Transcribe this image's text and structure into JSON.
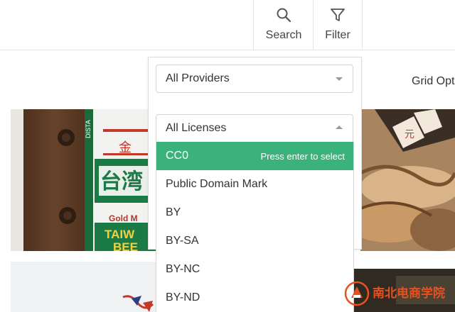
{
  "header": {
    "search_label": "Search",
    "filter_label": "Filter"
  },
  "grid_options_label": "Grid Opt",
  "filter": {
    "provider_select": {
      "value": "All Providers"
    },
    "license_select": {
      "value": "All Licenses"
    },
    "license_options": [
      {
        "label": "CC0",
        "hint": "Press enter to select",
        "active": true
      },
      {
        "label": "Public Domain Mark"
      },
      {
        "label": "BY"
      },
      {
        "label": "BY-SA"
      },
      {
        "label": "BY-NC"
      },
      {
        "label": "BY-ND"
      }
    ]
  },
  "photos": {
    "beer_can_text": [
      "DISTA",
      "金",
      "台湾",
      "Gold M",
      "TAIW",
      "BEE"
    ],
    "market_sign_text": "元"
  },
  "watermark": {
    "text": "南北电商学院"
  },
  "colors": {
    "accent_green": "#3bb27b",
    "border": "#dcdcdc",
    "watermark_orange": "#e8501e"
  },
  "icons": {
    "search": "magnifier-icon",
    "filter": "funnel-icon"
  }
}
